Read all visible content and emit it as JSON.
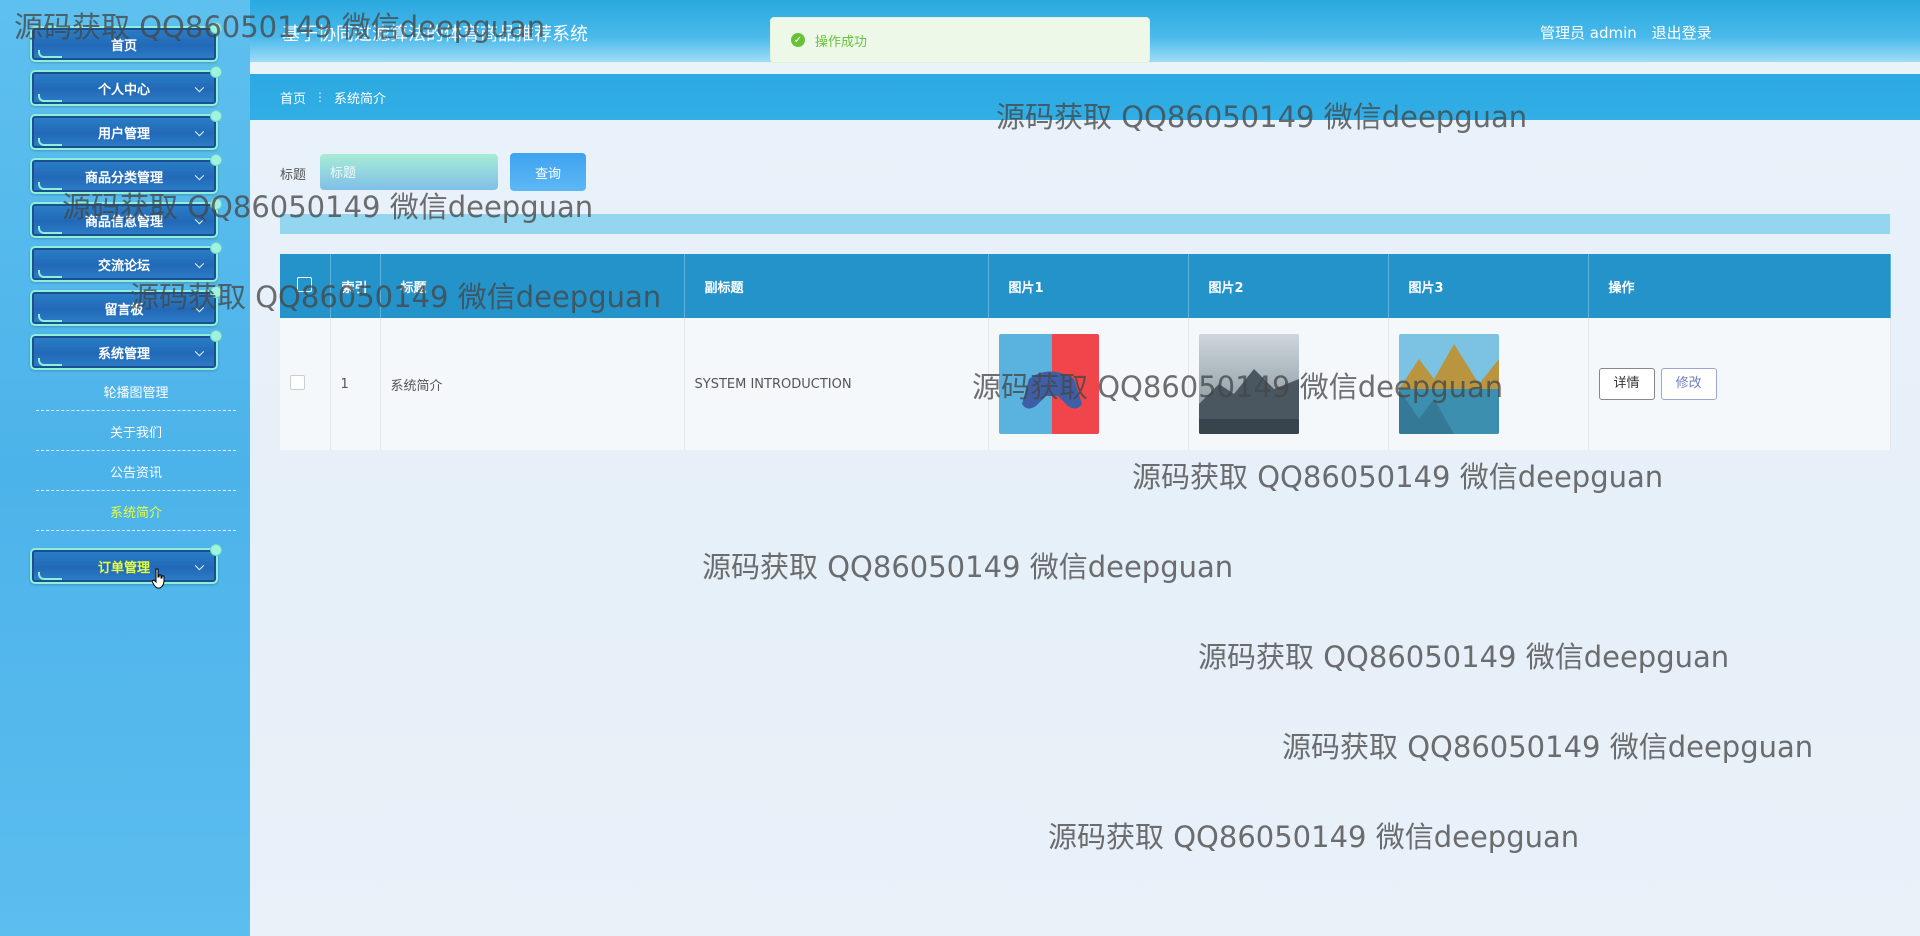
{
  "header": {
    "title": "基于协同过滤算法的体育商品推荐系统",
    "user_label": "管理员 admin",
    "logout_label": "退出登录"
  },
  "toast": {
    "message": "操作成功"
  },
  "sidebar": {
    "items": [
      {
        "label": "首页"
      },
      {
        "label": "个人中心"
      },
      {
        "label": "用户管理"
      },
      {
        "label": "商品分类管理"
      },
      {
        "label": "商品信息管理"
      },
      {
        "label": "交流论坛"
      },
      {
        "label": "留言板"
      },
      {
        "label": "系统管理"
      }
    ],
    "sub_items": [
      {
        "label": "轮播图管理"
      },
      {
        "label": "关于我们"
      },
      {
        "label": "公告资讯"
      },
      {
        "label": "系统简介"
      }
    ],
    "last_item": {
      "label": "订单管理"
    }
  },
  "breadcrumb": {
    "home": "首页",
    "current": "系统简介"
  },
  "search": {
    "label": "标题",
    "placeholder": "标题",
    "button": "查询"
  },
  "table": {
    "headers": [
      "索引",
      "标题",
      "副标题",
      "图片1",
      "图片2",
      "图片3",
      "操作"
    ],
    "rows": [
      {
        "index": "1",
        "title": "系统简介",
        "subtitle": "SYSTEM INTRODUCTION",
        "detail_label": "详情",
        "edit_label": "修改"
      }
    ]
  },
  "watermark": "源码获取 QQ86050149 微信deepguan",
  "colors": {
    "sidebar_bg": "#4cb3ea",
    "header_bg": "#2aa9e0",
    "table_header": "#2393c9",
    "active_menu_text": "#e7ff3a",
    "success": "#67c23a"
  }
}
